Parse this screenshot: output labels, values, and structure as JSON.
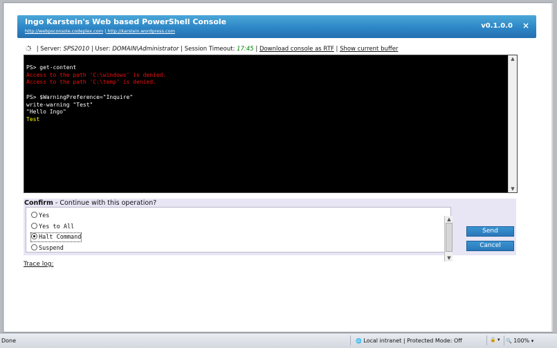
{
  "header": {
    "title": "Ingo Karstein's Web based PowerShell Console",
    "links": [
      "http://webpsconsole.codeplex.com",
      "http://karstein.wordpress.com"
    ],
    "version": "v0.1.0.0",
    "close_symbol": "×"
  },
  "status": {
    "server_label": "Server:",
    "server_value": "SPS2010",
    "user_label": "User:",
    "user_value": "DOMAIN\\Administrator",
    "timeout_label": "Session Timeout:",
    "timeout_value": "17:45",
    "download_link": "Download console as RTF",
    "buffer_link": "Show current buffer"
  },
  "console": {
    "lines": [
      {
        "text": "PS> get-content",
        "type": "normal"
      },
      {
        "text": "Access to the path 'C:\\windows' is denied.",
        "type": "red"
      },
      {
        "text": "Access to the path 'C:\\temp' is denied.",
        "type": "red"
      },
      {
        "text": "",
        "type": "normal"
      },
      {
        "text": "PS> $WarningPreference=\"Inquire\"",
        "type": "normal"
      },
      {
        "text": "write-warning \"Test\"",
        "type": "normal"
      },
      {
        "text": "\"Hello Ingo\"",
        "type": "normal"
      },
      {
        "text": "Test",
        "type": "yellow"
      }
    ]
  },
  "confirm": {
    "title_bold": "Confirm",
    "title_rest": " - Continue with this operation?",
    "options": [
      {
        "label": "Yes",
        "checked": false
      },
      {
        "label": "Yes to All",
        "checked": false
      },
      {
        "label": "Halt Command",
        "checked": true
      },
      {
        "label": "Suspend",
        "checked": false
      }
    ],
    "send_label": "Send",
    "cancel_label": "Cancel"
  },
  "trace_label": "Trace log:",
  "statusbar": {
    "left": "Done",
    "zone": "Local intranet | Protected Mode: Off",
    "zoom": "100%"
  },
  "colors": {
    "accent": "#2d86c6",
    "console_bg": "#000000",
    "error_text": "#ef1010",
    "warning_text": "#ffff00"
  }
}
